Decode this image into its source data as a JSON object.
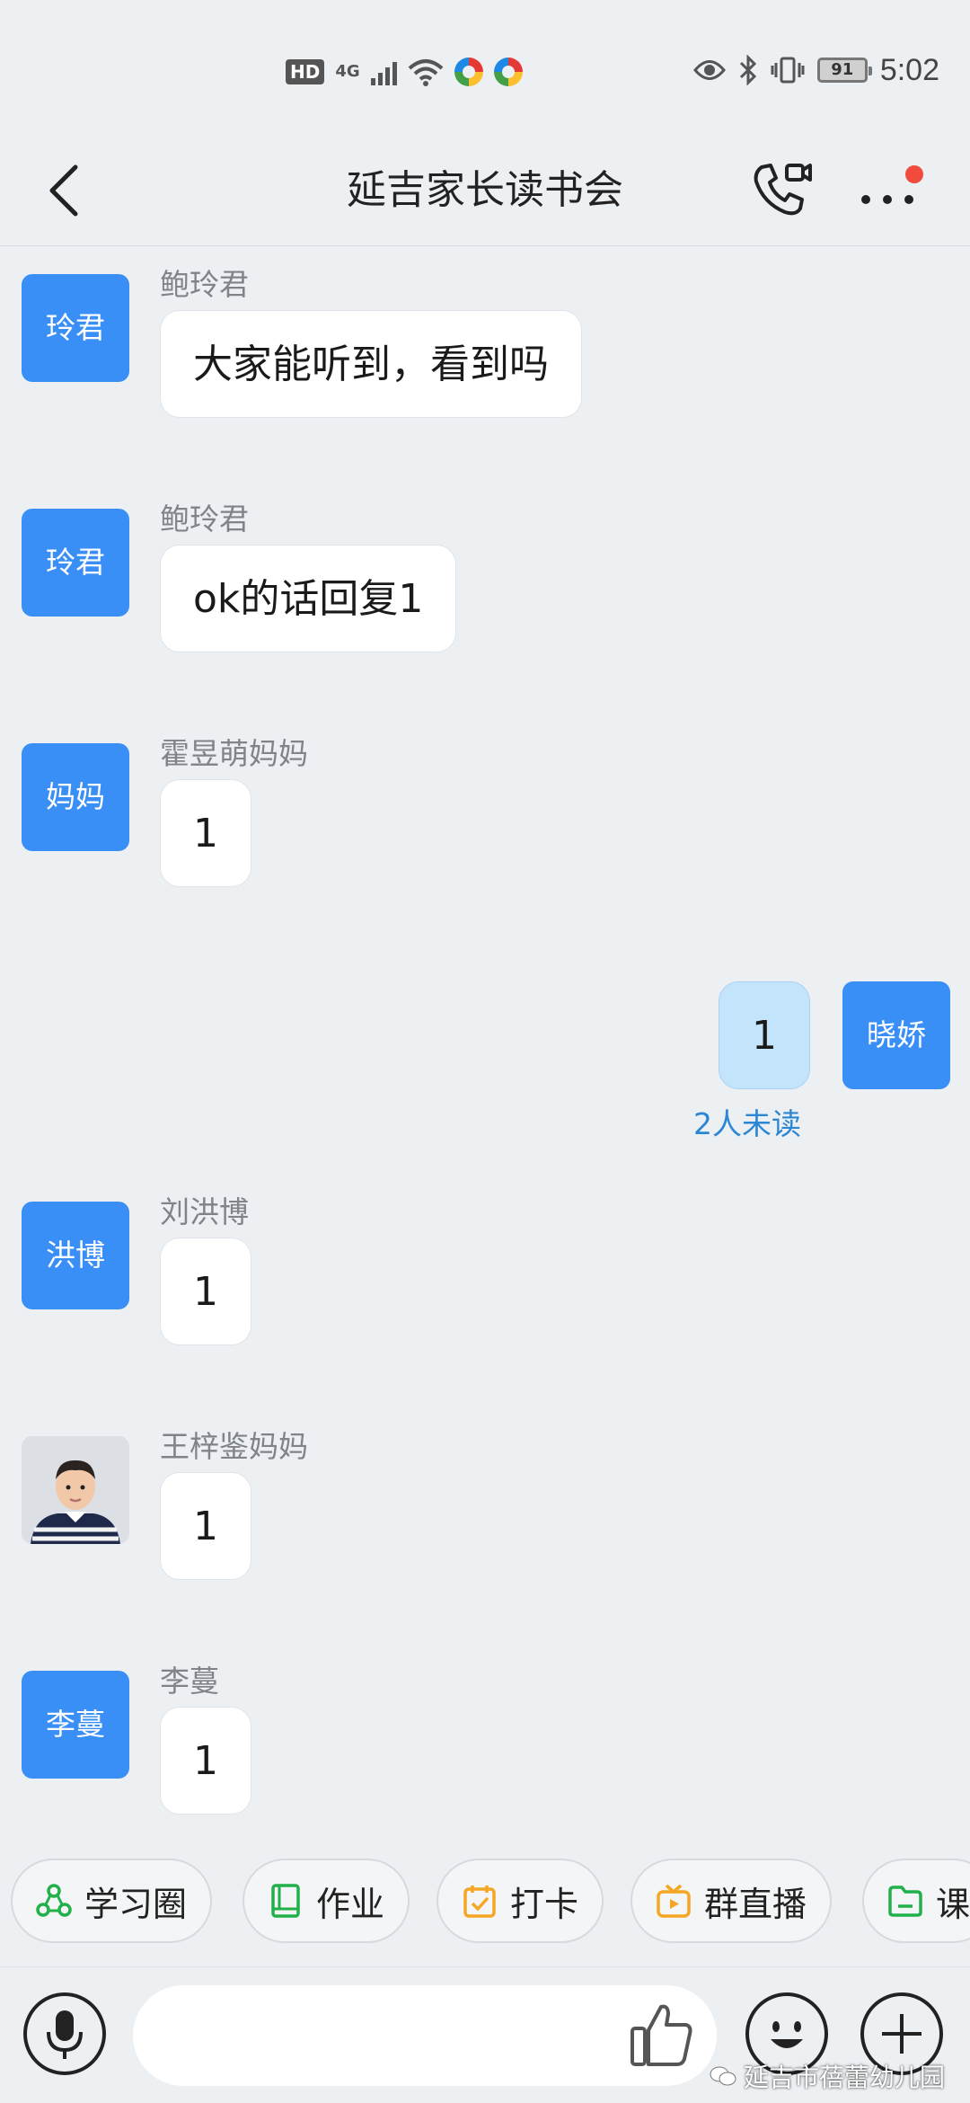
{
  "status_bar": {
    "hd": "HD",
    "network": "4G",
    "battery": "91",
    "time": "5:02"
  },
  "header": {
    "title": "延吉家长读书会",
    "back_icon": "chevron-left-icon",
    "call_icon": "phone-video-icon",
    "more_icon": "more-dots-icon",
    "notification_color": "#f04b3c"
  },
  "messages": [
    {
      "sender": "鲍玲君",
      "avatar_text": "玲君",
      "text": "大家能听到，看到吗"
    },
    {
      "sender": "鲍玲君",
      "avatar_text": "玲君",
      "text": "ok的话回复1"
    },
    {
      "sender": "霍昱萌妈妈",
      "avatar_text": "妈妈",
      "text": "1"
    },
    {
      "own": true,
      "avatar_text": "晓娇",
      "text": "1",
      "status": "2人未读"
    },
    {
      "sender": "刘洪博",
      "avatar_text": "洪博",
      "text": "1"
    },
    {
      "sender": "王梓鉴妈妈",
      "avatar_icon": "child-photo-avatar",
      "text": "1"
    },
    {
      "sender": "李蔓",
      "avatar_text": "李蔓",
      "text": "1"
    }
  ],
  "quick_actions": [
    {
      "label": "学习圈",
      "icon": "study-circle-icon",
      "color": "#22b04a"
    },
    {
      "label": "作业",
      "icon": "homework-book-icon",
      "color": "#22b04a"
    },
    {
      "label": "打卡",
      "icon": "checkin-calendar-icon",
      "color": "#f5a623"
    },
    {
      "label": "群直播",
      "icon": "live-tv-icon",
      "color": "#f5a623"
    },
    {
      "label": "课",
      "icon": "folder-icon",
      "color": "#22b04a"
    }
  ],
  "input": {
    "placeholder": "",
    "mic_icon": "microphone-icon",
    "like_icon": "thumbs-up-icon",
    "emoji_icon": "smiley-icon",
    "plus_icon": "plus-icon"
  },
  "watermark": "延吉市蓓蕾幼儿园",
  "colors": {
    "background": "#ecf0f3",
    "avatar_blue": "#3a8ff6",
    "own_bubble": "#c4e4fc",
    "unread_text": "#2b86d4"
  }
}
